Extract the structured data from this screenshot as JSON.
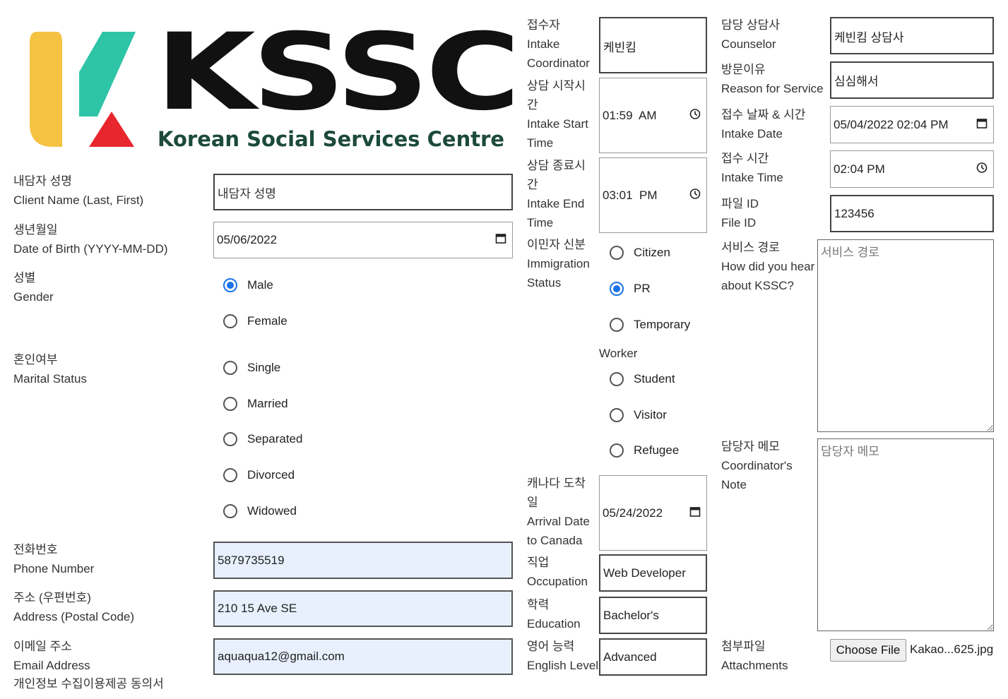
{
  "logo": {
    "text": "KSSC",
    "subtitle": "Korean Social Services Centre",
    "colors": {
      "yellow": "#f5c242",
      "teal": "#2ec4a6",
      "red": "#e8262d",
      "text": "#111111",
      "subtitle": "#1c4a3c"
    }
  },
  "left": {
    "client_name": {
      "ko": "내담자 성명",
      "en": "Client Name (Last, First)",
      "placeholder": "내담자 성명"
    },
    "dob": {
      "ko": "생년월일",
      "en": "Date of Birth (YYYY-MM-DD)",
      "value": "05/06/2022"
    },
    "gender": {
      "ko": "성별",
      "en": "Gender",
      "options": [
        "Male",
        "Female"
      ],
      "selected": "Male"
    },
    "marital": {
      "ko": "혼인여부",
      "en": "Marital Status",
      "options": [
        "Single",
        "Married",
        "Separated",
        "Divorced",
        "Widowed"
      ]
    },
    "phone": {
      "ko": "전화번호",
      "en": "Phone Number",
      "value": "5879735519"
    },
    "address": {
      "ko": "주소 (우편번호)",
      "en": "Address (Postal Code)",
      "value": "210 15 Ave SE"
    },
    "email": {
      "ko": "이메일 주소",
      "en": "Email Address",
      "value": "aquaqua12@gmail.com"
    },
    "consent": {
      "ko": "개인정보 수집이용제공 동의서"
    }
  },
  "middle": {
    "coordinator": {
      "ko": "접수자",
      "en1": "Intake",
      "en2": "Coordinator",
      "value": "케빈킴"
    },
    "start_time": {
      "ko1": "상담 시작시",
      "ko2": "간",
      "en1": "Intake Start",
      "en2": "Time",
      "value": "01:59  AM"
    },
    "end_time": {
      "ko1": "상담 종료시",
      "ko2": "간",
      "en1": "Intake End",
      "en2": "Time",
      "value": "03:01  PM"
    },
    "immigration": {
      "ko": "이민자 신분",
      "en1": "Immigration",
      "en2": "Status",
      "options": [
        "Citizen",
        "PR",
        "Temporary",
        "Student",
        "Visitor",
        "Refugee"
      ],
      "temporary_wrap": "Worker",
      "selected": "PR"
    },
    "arrival": {
      "ko1": "캐나다 도착",
      "ko2": "일",
      "en1": "Arrival Date",
      "en2": "to Canada",
      "value": "05/24/2022"
    },
    "occupation": {
      "ko": "직업",
      "en": "Occupation",
      "value": "Web Developer"
    },
    "education": {
      "ko": "학력",
      "en": "Education",
      "value": "Bachelor's"
    },
    "english": {
      "ko": "영어 능력",
      "en": "English Level",
      "value": "Advanced"
    }
  },
  "right": {
    "counselor": {
      "ko": "담당 상담사",
      "en": "Counselor",
      "value": "케빈킴 상담사"
    },
    "reason": {
      "ko": "방문이유",
      "en": "Reason for Service",
      "value": "심심해서"
    },
    "intake_date": {
      "ko": "접수 날짜 & 시간",
      "en": "Intake Date",
      "value": "05/04/2022 02:04 PM"
    },
    "intake_time": {
      "ko": "접수 시간",
      "en": "Intake Time",
      "value": "02:04 PM"
    },
    "file_id": {
      "ko": "파일 ID",
      "en": "File ID",
      "value": "123456"
    },
    "referral": {
      "ko": "서비스 경로",
      "en1": "How did you hear",
      "en2": "about KSSC?",
      "placeholder": "서비스 경로"
    },
    "note": {
      "ko": "담당자 메모",
      "en1": "Coordinator's",
      "en2": "Note",
      "placeholder": "담당자 메모"
    },
    "attachments": {
      "ko": "첨부파일",
      "en": "Attachments",
      "button": "Choose File",
      "filename": "Kakao...625.jpg"
    }
  }
}
